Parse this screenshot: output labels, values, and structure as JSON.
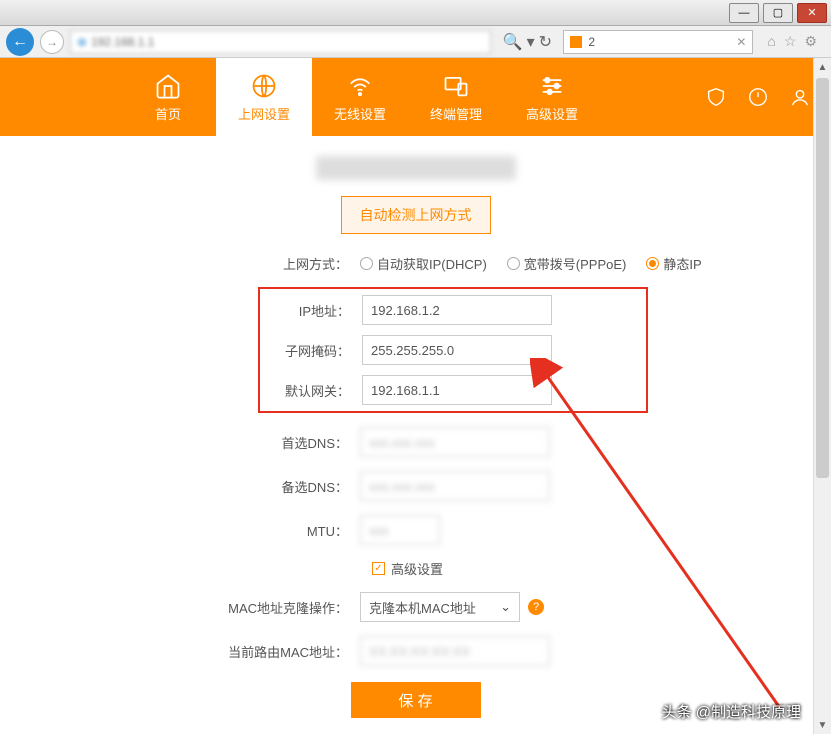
{
  "browser": {
    "tab_label": "2",
    "address_blur": "192.168.1.1"
  },
  "nav": {
    "home": "首页",
    "internet": "上网设置",
    "wireless": "无线设置",
    "terminal": "终端管理",
    "advanced": "高级设置"
  },
  "form": {
    "auto_detect": "自动检测上网方式",
    "method_label": "上网方式：",
    "dhcp": "自动获取IP(DHCP)",
    "pppoe": "宽带拨号(PPPoE)",
    "static": "静态IP",
    "ip_label": "IP地址：",
    "ip_value": "192.168.1.2",
    "mask_label": "子网掩码：",
    "mask_value": "255.255.255.0",
    "gateway_label": "默认网关：",
    "gateway_value": "192.168.1.1",
    "dns1_label": "首选DNS：",
    "dns2_label": "备选DNS：",
    "mtu_label": "MTU：",
    "advanced_check": "高级设置",
    "mac_clone_label": "MAC地址克隆操作：",
    "mac_clone_value": "克隆本机MAC地址",
    "current_mac_label": "当前路由MAC地址：",
    "save": "保 存"
  },
  "watermark": "头条 @制造科技原理"
}
